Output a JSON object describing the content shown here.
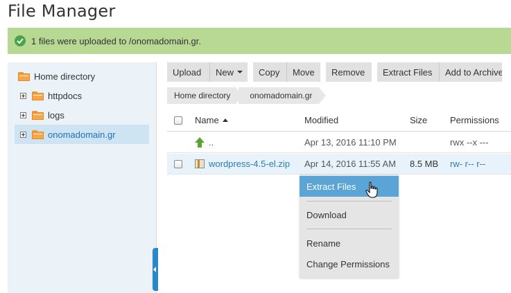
{
  "page": {
    "title": "File Manager"
  },
  "alert": {
    "message": "1 files were uploaded to /onomadomain.gr.",
    "color": "#b7d993"
  },
  "tree": {
    "items": [
      {
        "label": "Home directory",
        "icon": "folder-icon"
      },
      {
        "label": "httpdocs",
        "icon": "folder-icon",
        "expandable": true
      },
      {
        "label": "logs",
        "icon": "folder-icon",
        "expandable": true
      },
      {
        "label": "onomadomain.gr",
        "icon": "folder-icon",
        "expandable": true,
        "selected": true
      }
    ]
  },
  "toolbar": {
    "upload": "Upload",
    "new": "New",
    "copy": "Copy",
    "move": "Move",
    "remove": "Remove",
    "extract": "Extract Files",
    "archive": "Add to Archive"
  },
  "breadcrumb": [
    "Home directory",
    "onomadomain.gr"
  ],
  "table": {
    "headers": {
      "name": "Name",
      "modified": "Modified",
      "size": "Size",
      "permissions": "Permissions"
    },
    "rows": [
      {
        "name": "..",
        "modified": "Apr 13, 2016 11:10 PM",
        "size": "",
        "permissions": "rwx --x ---"
      },
      {
        "name": "wordpress-4.5-el.zip",
        "modified": "Apr 14, 2016 11:55 AM",
        "size": "8.5 MB",
        "permissions": "rw- r-- r--"
      }
    ]
  },
  "context_menu": {
    "items": [
      "Extract Files",
      "Download",
      "Rename",
      "Change Permissions"
    ],
    "active_color": "#5aa4d6"
  }
}
